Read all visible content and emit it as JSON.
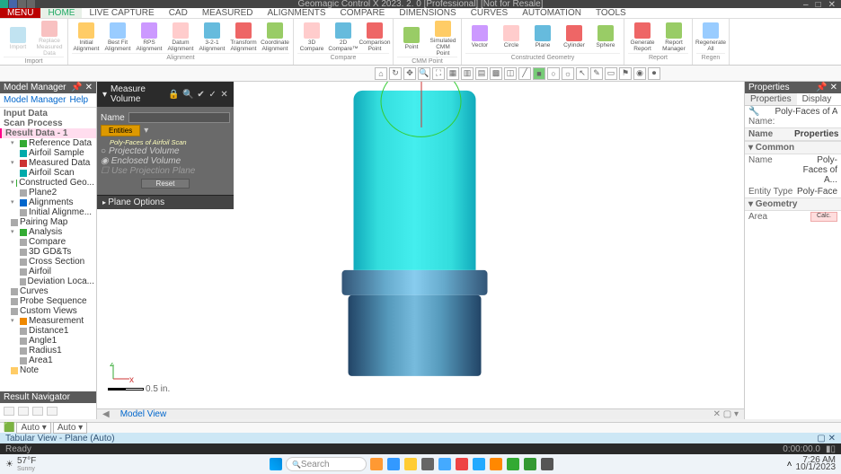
{
  "app": {
    "title": "Geomagic Control X 2023. 2. 0 [Professional] [Not for Resale]",
    "win_buttons": [
      "–",
      "□",
      "✕"
    ]
  },
  "menubar": {
    "menu": "MENU",
    "tabs": [
      "HOME",
      "LIVE CAPTURE",
      "CAD",
      "MEASURED",
      "ALIGNMENTS",
      "COMPARE",
      "DIMENSIONS",
      "CURVES",
      "AUTOMATION",
      "TOOLS"
    ]
  },
  "ribbon": {
    "groups": [
      {
        "label": "Import",
        "buttons": [
          {
            "t": "Import"
          },
          {
            "t": "Replace\nMeasured Data"
          }
        ]
      },
      {
        "label": "Alignment",
        "buttons": [
          {
            "t": "Initial\nAlignment"
          },
          {
            "t": "Best Fit\nAlignment"
          },
          {
            "t": "RPS\nAlignment"
          },
          {
            "t": "Datum\nAlignment"
          },
          {
            "t": "3-2-1\nAlignment"
          },
          {
            "t": "Transform\nAlignment"
          },
          {
            "t": "Coordinate\nAlignment"
          }
        ]
      },
      {
        "label": "Compare",
        "buttons": [
          {
            "t": "3D\nCompare"
          },
          {
            "t": "2D\nCompare™"
          },
          {
            "t": "Comparison\nPoint"
          }
        ]
      },
      {
        "label": "CMM Point",
        "buttons": [
          {
            "t": "Point"
          },
          {
            "t": "Simulated\nCMM Point"
          }
        ]
      },
      {
        "label": "Constructed Geometry",
        "buttons": [
          {
            "t": "Vector"
          },
          {
            "t": "Circle"
          },
          {
            "t": "Plane"
          },
          {
            "t": "Cylinder"
          },
          {
            "t": "Sphere"
          }
        ]
      },
      {
        "label": "Report",
        "buttons": [
          {
            "t": "Generate\nReport"
          },
          {
            "t": "Report\nManager"
          }
        ]
      },
      {
        "label": "Regen",
        "buttons": [
          {
            "t": "Regenerate\nAll"
          }
        ]
      }
    ]
  },
  "left": {
    "header": "Model Manager",
    "tabs": [
      "Model Manager",
      "Help"
    ],
    "tree": [
      {
        "t": "Input Data",
        "cls": "hdr"
      },
      {
        "t": "Scan Process",
        "cls": "hdr"
      },
      {
        "t": "Result Data - 1",
        "cls": "sel hdr"
      },
      {
        "t": "Reference Data",
        "cls": "i1",
        "i": "green",
        "a": "▾"
      },
      {
        "t": "Airfoil Sample",
        "cls": "i2",
        "i": "teal"
      },
      {
        "t": "Measured Data",
        "cls": "i1",
        "i": "red",
        "a": "▾"
      },
      {
        "t": "Airfoil Scan",
        "cls": "i2",
        "i": "teal"
      },
      {
        "t": "Constructed Geo...",
        "cls": "i1",
        "i": "green",
        "a": "▾"
      },
      {
        "t": "Plane2",
        "cls": "i2",
        "i": "gray"
      },
      {
        "t": "Alignments",
        "cls": "i1",
        "i": "blue",
        "a": "▾"
      },
      {
        "t": "Initial Alignme...",
        "cls": "i2",
        "i": "gray"
      },
      {
        "t": "Pairing Map",
        "cls": "i1",
        "i": "gray"
      },
      {
        "t": "Analysis",
        "cls": "i1",
        "i": "green",
        "a": "▾"
      },
      {
        "t": "Compare",
        "cls": "i2",
        "i": "gray"
      },
      {
        "t": "3D GD&Ts",
        "cls": "i2",
        "i": "gray"
      },
      {
        "t": "Cross Section",
        "cls": "i2",
        "i": "gray"
      },
      {
        "t": "Airfoil",
        "cls": "i2",
        "i": "gray"
      },
      {
        "t": "Deviation Loca...",
        "cls": "i2",
        "i": "gray"
      },
      {
        "t": "Curves",
        "cls": "i1",
        "i": "gray"
      },
      {
        "t": "Probe Sequence",
        "cls": "i1",
        "i": "gray"
      },
      {
        "t": "Custom Views",
        "cls": "i1",
        "i": "gray"
      },
      {
        "t": "Measurement",
        "cls": "i1",
        "i": "orange",
        "a": "▾"
      },
      {
        "t": "Distance1",
        "cls": "i2",
        "i": "gray"
      },
      {
        "t": "Angle1",
        "cls": "i2",
        "i": "gray"
      },
      {
        "t": "Radius1",
        "cls": "i2",
        "i": "gray"
      },
      {
        "t": "Area1",
        "cls": "i2",
        "i": "gray"
      },
      {
        "t": "Note",
        "cls": "i1",
        "i": "note"
      }
    ],
    "result_nav": "Result Navigator"
  },
  "measure_panel": {
    "title": "Measure Volume",
    "name_lbl": "Name",
    "name_val": "",
    "entities_btn": "Entities",
    "selected": "Poly-Faces of Airfoil Scan",
    "opt_projected": "Projected Volume",
    "opt_enclosed": "Enclosed Volume",
    "use_plane": "Use Projection Plane",
    "reset": "Reset",
    "plane_opts": "Plane Options"
  },
  "viewport": {
    "scale": "0.5 in.",
    "model_view_tab": "Model View",
    "tabular": "Tabular View - Plane (Auto)"
  },
  "right": {
    "header": "Properties",
    "tabs": [
      "Properties",
      "Display"
    ],
    "name_row": {
      "k": "Name:",
      "v": "Poly-Faces of Airfoil"
    },
    "columns": {
      "k": "Name",
      "v": "Properties"
    },
    "groups": [
      {
        "hdr": "Common",
        "rows": [
          {
            "k": "Name",
            "v": "Poly-Faces of A..."
          },
          {
            "k": "Entity Type",
            "v": "Poly-Face"
          }
        ]
      },
      {
        "hdr": "Geometry",
        "rows": [
          {
            "k": "Area",
            "v": "Calc.",
            "calc": true
          }
        ]
      }
    ]
  },
  "status_row": {
    "combo1": "Auto ▾",
    "combo2": "Auto ▾"
  },
  "statusbar": {
    "left": "Ready",
    "time": "0:00:00.0"
  },
  "taskbar": {
    "weather_temp": "57°F",
    "weather_cond": "Sunny",
    "search": "Search",
    "clock_time": "7:26 AM",
    "clock_date": "10/1/2023"
  }
}
